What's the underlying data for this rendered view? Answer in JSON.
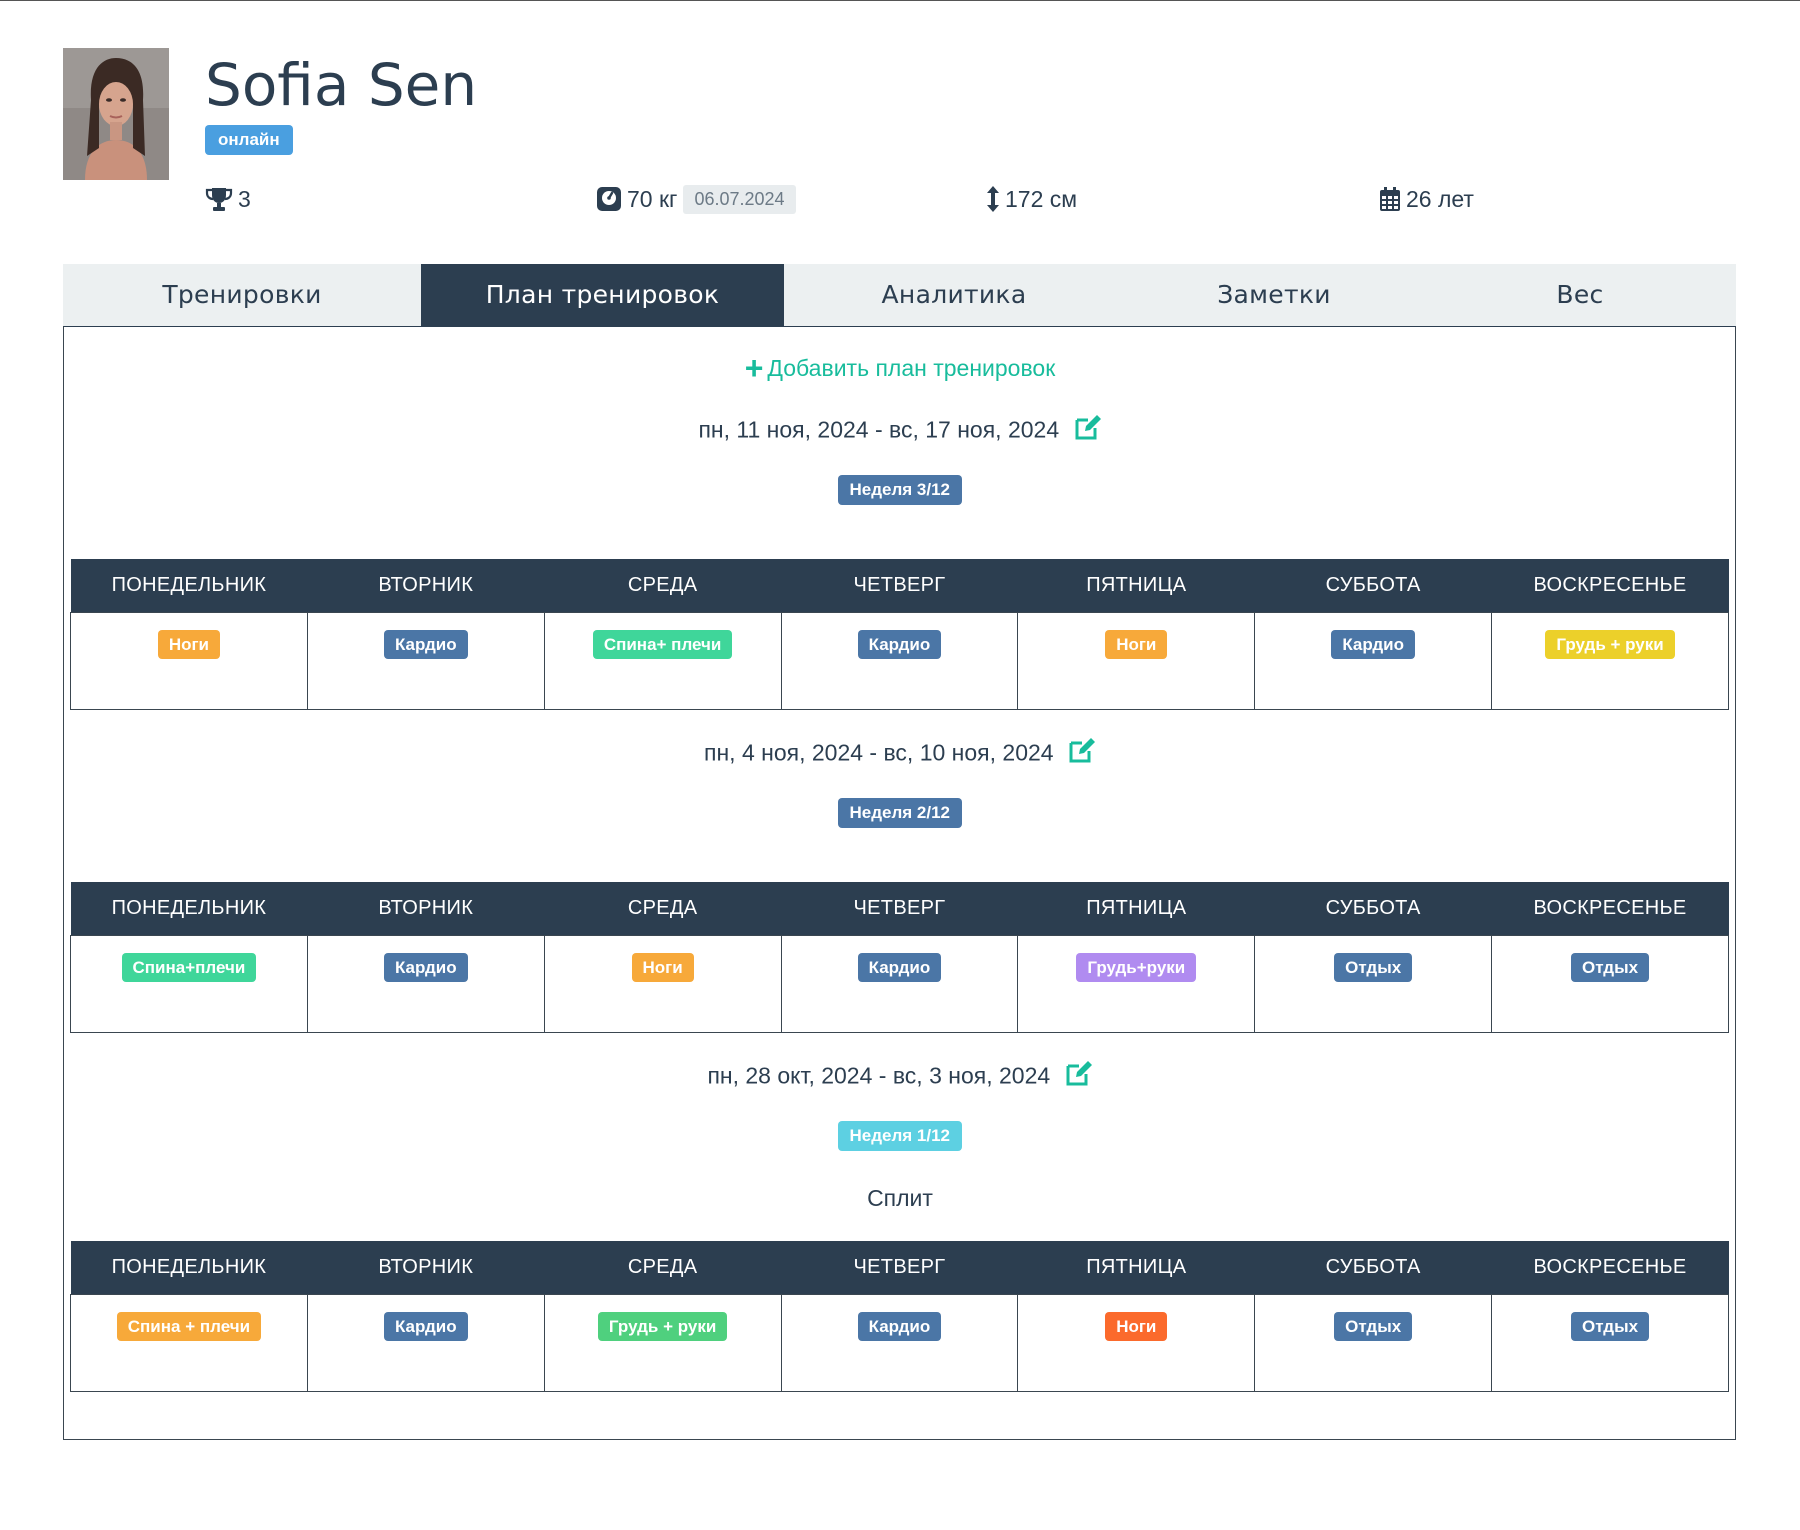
{
  "profile": {
    "name": "Sofia Sen",
    "status": "онлайн",
    "trophies": "3",
    "weight": "70 кг",
    "weight_date": "06.07.2024",
    "height": "172 см",
    "age": "26 лет"
  },
  "tabs": [
    {
      "label": "Тренировки",
      "active": false
    },
    {
      "label": "План тренировок",
      "active": true
    },
    {
      "label": "Аналитика",
      "active": false
    },
    {
      "label": "Заметки",
      "active": false
    },
    {
      "label": "Вес",
      "active": false
    }
  ],
  "add_plan_label": "Добавить план тренировок",
  "days": [
    "ПОНЕДЕЛЬНИК",
    "ВТОРНИК",
    "СРЕДА",
    "ЧЕТВЕРГ",
    "ПЯТНИЦА",
    "СУББОТА",
    "ВОСКРЕСЕНЬЕ"
  ],
  "weeks": [
    {
      "range": "пн, 11 ноя, 2024 - вс, 17 ноя, 2024",
      "week_label": "Неделя 3/12",
      "week_color": "#4b76a6",
      "split": "",
      "workouts": [
        {
          "label": "Ноги",
          "color": "#f7a93a"
        },
        {
          "label": "Кардио",
          "color": "#4b76a6"
        },
        {
          "label": "Спина+ плечи",
          "color": "#3fd69a"
        },
        {
          "label": "Кардио",
          "color": "#4b76a6"
        },
        {
          "label": "Ноги",
          "color": "#f7a93a"
        },
        {
          "label": "Кардио",
          "color": "#4b76a6"
        },
        {
          "label": "Грудь + руки",
          "color": "#ecd02a"
        }
      ]
    },
    {
      "range": "пн, 4 ноя, 2024 - вс, 10 ноя, 2024",
      "week_label": "Неделя 2/12",
      "week_color": "#4b76a6",
      "split": "",
      "workouts": [
        {
          "label": "Спина+плечи",
          "color": "#3fd69a"
        },
        {
          "label": "Кардио",
          "color": "#4b76a6"
        },
        {
          "label": "Ноги",
          "color": "#f7a93a"
        },
        {
          "label": "Кардио",
          "color": "#4b76a6"
        },
        {
          "label": "Грудь+руки",
          "color": "#b08bf0"
        },
        {
          "label": "Отдых",
          "color": "#4b76a6"
        },
        {
          "label": "Отдых",
          "color": "#4b76a6"
        }
      ]
    },
    {
      "range": "пн, 28 окт, 2024 - вс, 3 ноя, 2024",
      "week_label": "Неделя 1/12",
      "week_color": "#5dd0e2",
      "split": "Сплит",
      "workouts": [
        {
          "label": "Спина + плечи",
          "color": "#f7a93a"
        },
        {
          "label": "Кардио",
          "color": "#4b76a6"
        },
        {
          "label": "Грудь + руки",
          "color": "#4fd07e"
        },
        {
          "label": "Кардио",
          "color": "#4b76a6"
        },
        {
          "label": "Ноги",
          "color": "#fb6a2c"
        },
        {
          "label": "Отдых",
          "color": "#4b76a6"
        },
        {
          "label": "Отдых",
          "color": "#4b76a6"
        }
      ]
    }
  ],
  "colors": {
    "primary": "#2c3e50",
    "accent": "#18bc9c",
    "status": "#4a9fe0"
  },
  "icons": {
    "trophy": "trophy-icon",
    "weight": "weight-scale-icon",
    "height": "height-arrows-icon",
    "age": "calendar-icon",
    "edit": "edit-icon",
    "add": "plus-icon"
  }
}
